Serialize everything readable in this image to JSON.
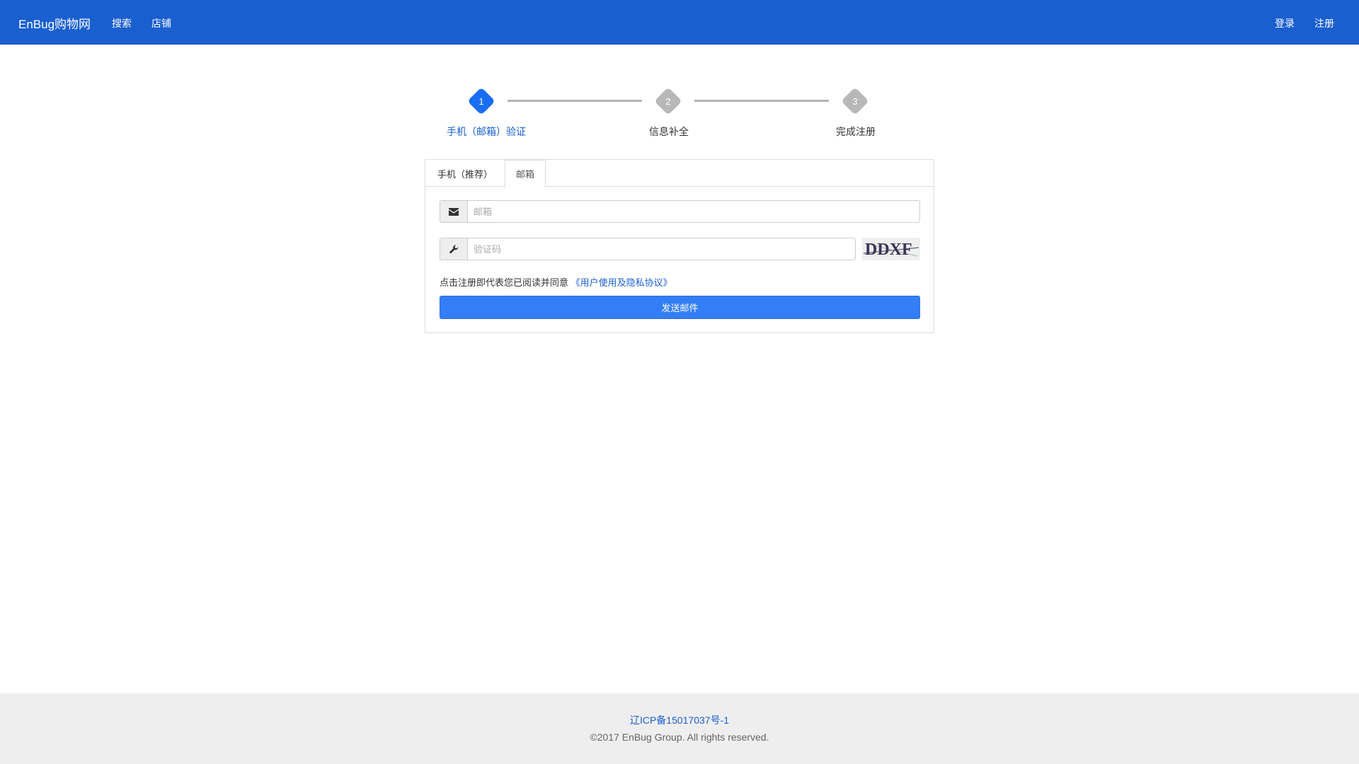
{
  "navbar": {
    "brand": "EnBug购物网",
    "links": [
      "搜索",
      "店铺"
    ],
    "login": "登录",
    "register": "注册"
  },
  "steps": [
    {
      "number": "1",
      "label": "手机（邮箱）验证",
      "state": "active"
    },
    {
      "number": "2",
      "label": "信息补全",
      "state": "pending"
    },
    {
      "number": "3",
      "label": "完成注册",
      "state": "pending"
    }
  ],
  "tabs": [
    {
      "label": "手机（推荐）",
      "active": false
    },
    {
      "label": "邮箱",
      "active": true
    }
  ],
  "form": {
    "email_placeholder": "邮箱",
    "email_value": "",
    "captcha_placeholder": "验证码",
    "captcha_value": "",
    "captcha_text": "DDXF",
    "agreement_prefix": "点击注册即代表您已阅读并同意",
    "agreement_link": "《用户使用及隐私协议》",
    "submit": "发送邮件"
  },
  "footer": {
    "icp": "辽ICP备15017037号-1",
    "copyright": "©2017 EnBug Group. All rights reserved."
  },
  "colors": {
    "navbar": "#1a5fcf",
    "active_step": "#1a6ef5",
    "pending_step": "#b8b8b8",
    "link": "#1a5fcf",
    "button": "#337ef6",
    "footer_bg": "#eeeeee"
  }
}
